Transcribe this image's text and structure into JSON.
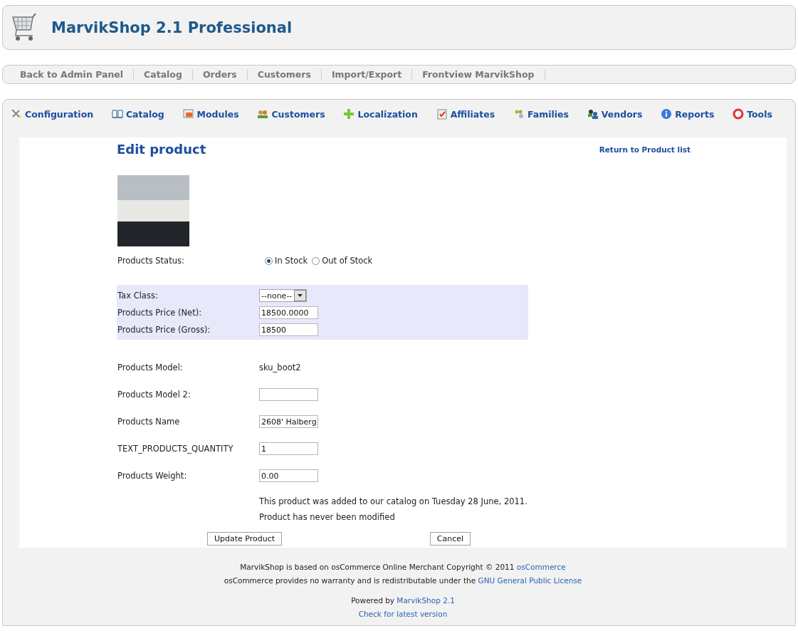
{
  "header": {
    "title": "MarvikShop 2.1 Professional"
  },
  "top_nav": [
    {
      "label": "Back to Admin Panel"
    },
    {
      "label": "Catalog"
    },
    {
      "label": "Orders"
    },
    {
      "label": "Customers"
    },
    {
      "label": "Import/Export"
    },
    {
      "label": "Frontview MarvikShop"
    }
  ],
  "icon_nav": [
    {
      "label": "Configuration"
    },
    {
      "label": "Catalog"
    },
    {
      "label": "Modules"
    },
    {
      "label": "Customers"
    },
    {
      "label": "Localization"
    },
    {
      "label": "Affiliates"
    },
    {
      "label": "Families"
    },
    {
      "label": "Vendors"
    },
    {
      "label": "Reports"
    },
    {
      "label": "Tools"
    }
  ],
  "page": {
    "title": "Edit product",
    "return_link": "Return to Product list"
  },
  "status": {
    "label": "Products Status:",
    "options": [
      {
        "label": "In Stock",
        "selected": true
      },
      {
        "label": "Out of Stock",
        "selected": false
      }
    ]
  },
  "tax_rows": [
    {
      "label": "Tax Class:",
      "kind": "select",
      "value": "--none--"
    },
    {
      "label": "Products Price (Net):",
      "kind": "input",
      "value": "18500.0000"
    },
    {
      "label": "Products Price (Gross):",
      "kind": "input",
      "value": "18500"
    }
  ],
  "detail_rows": [
    {
      "label": "Products Model:",
      "kind": "text",
      "value": "sku_boot2"
    },
    {
      "label": "Products Model 2:",
      "kind": "input"
    },
    {
      "label": "Products Name",
      "kind": "input",
      "value": "2608' Halberg"
    },
    {
      "label": "TEXT_PRODUCTS_QUANTITY",
      "kind": "input",
      "value": "1"
    },
    {
      "label": "Products Weight:",
      "kind": "input",
      "value": "0.00"
    }
  ],
  "notes": [
    "This product was added to our catalog on Tuesday 28 June, 2011.",
    "Product has never been modified"
  ],
  "buttons": [
    "Update Product",
    "Cancel"
  ],
  "footer": [
    {
      "text": "MarvikShop is based on osCommerce Online Merchant Copyright © 2011 ",
      "link": "osCommerce"
    },
    {
      "text": "osCommerce provides no warranty and is redistributable under the ",
      "link": "GNU General Public License"
    },
    {
      "text": "Powered by ",
      "link": "MarvikShop 2.1"
    },
    {
      "link": "Check for latest version"
    }
  ]
}
